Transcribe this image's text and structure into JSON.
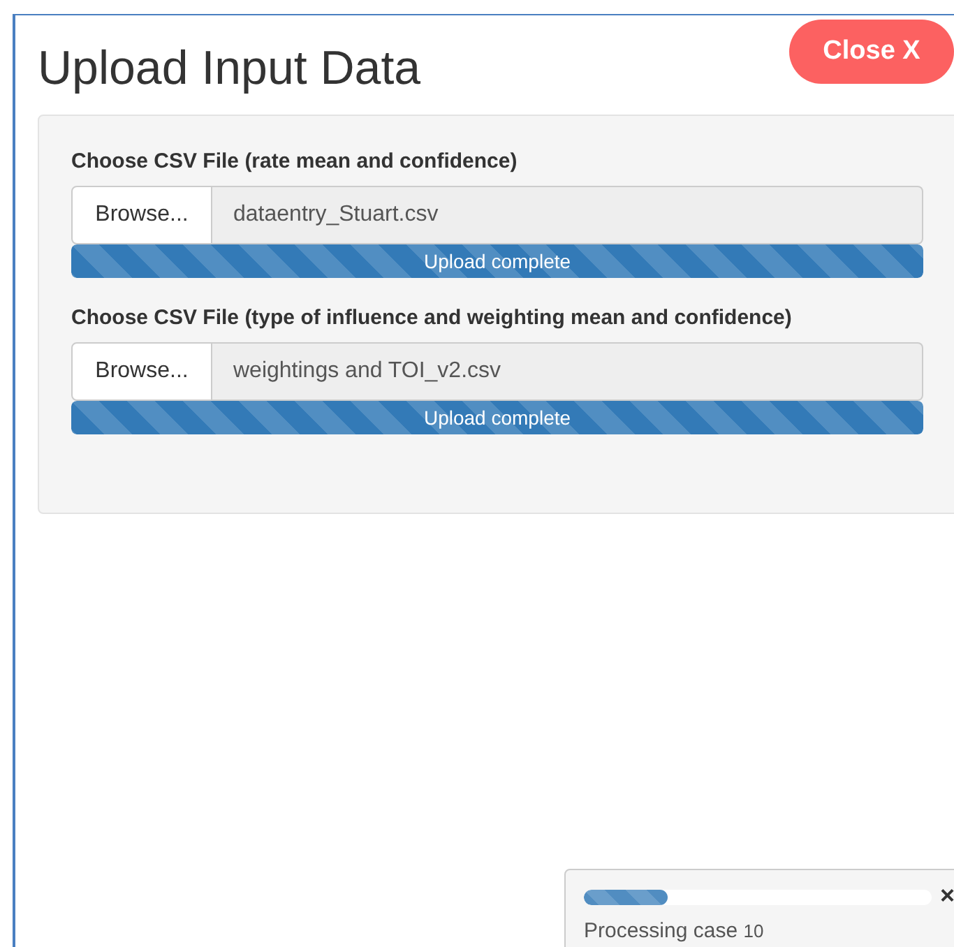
{
  "modal": {
    "title": "Upload Input Data",
    "close_button": "Close X"
  },
  "uploads": [
    {
      "label": "Choose CSV File (rate mean and confidence)",
      "browse": "Browse...",
      "file": "dataentry_Stuart.csv",
      "progress": {
        "level": 1,
        "text": "Upload complete"
      }
    },
    {
      "label": "Choose CSV File (type of influence and weighting mean and confidence)",
      "browse": "Browse...",
      "file": "weightings and TOI_v2.csv",
      "progress": {
        "level": 1,
        "text": "Upload complete"
      }
    }
  ],
  "notification": {
    "level": 0.24,
    "message": "Processing case",
    "detail": "10",
    "close": "×"
  }
}
